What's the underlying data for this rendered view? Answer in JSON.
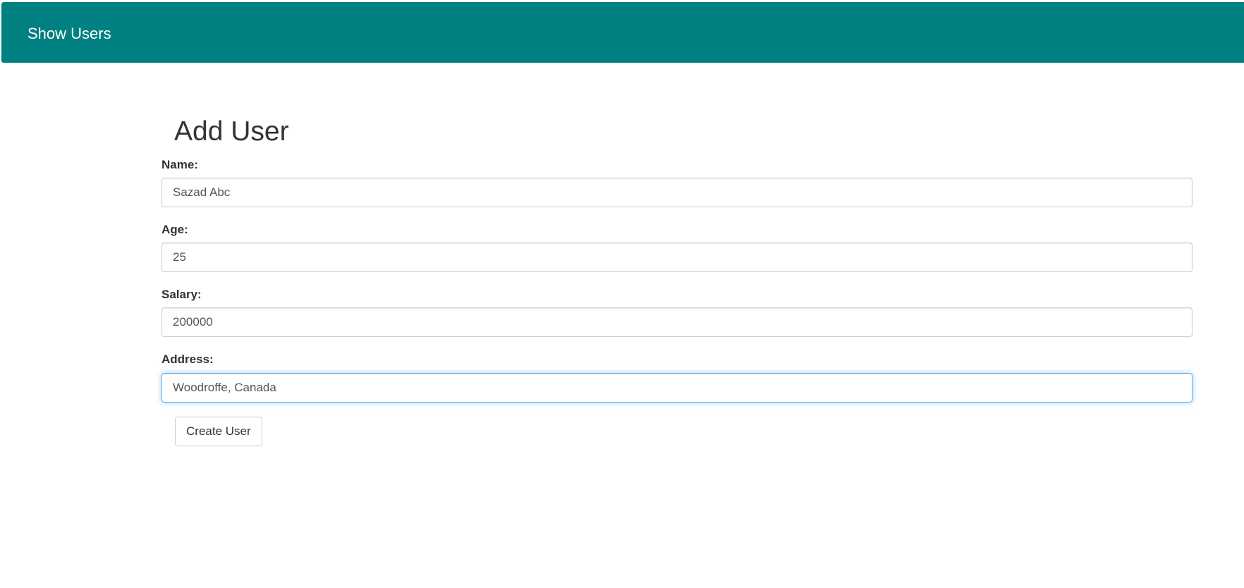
{
  "navbar": {
    "link_label": "Show Users",
    "background_color": "#008080"
  },
  "form": {
    "title": "Add User",
    "fields": [
      {
        "label": "Name:",
        "value": "Sazad Abc"
      },
      {
        "label": "Age:",
        "value": "25"
      },
      {
        "label": "Salary:",
        "value": "200000"
      },
      {
        "label": "Address:",
        "value": "Woodroffe, Canada",
        "focused": true
      }
    ],
    "submit_label": "Create User"
  }
}
